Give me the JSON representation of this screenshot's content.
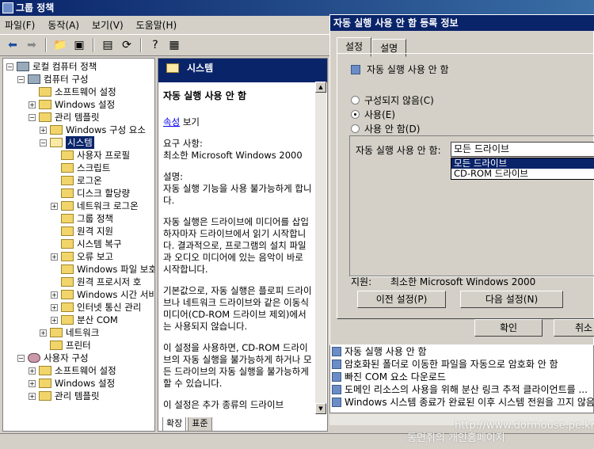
{
  "window": {
    "title": "그룹 정책"
  },
  "menu": [
    "파일(F)",
    "동작(A)",
    "보기(V)",
    "도움말(H)"
  ],
  "tree": [
    {
      "label": "로컬 컴퓨터 정책",
      "indent": 0,
      "pm": "−",
      "icon": "computer-policy-icon"
    },
    {
      "label": "컴퓨터 구성",
      "indent": 1,
      "pm": "−",
      "icon": "computer-icon"
    },
    {
      "label": "소프트웨어 설정",
      "indent": 2,
      "pm": "",
      "icon": "folder-icon"
    },
    {
      "label": "Windows 설정",
      "indent": 2,
      "pm": "+",
      "icon": "folder-icon"
    },
    {
      "label": "관리 템플릿",
      "indent": 2,
      "pm": "−",
      "icon": "folder-icon"
    },
    {
      "label": "Windows 구성 요소",
      "indent": 3,
      "pm": "+",
      "icon": "folder-icon"
    },
    {
      "label": "시스템",
      "indent": 3,
      "pm": "−",
      "icon": "open-folder-icon",
      "selected": true
    },
    {
      "label": "사용자 프로필",
      "indent": 4,
      "pm": "",
      "icon": "folder-icon"
    },
    {
      "label": "스크립트",
      "indent": 4,
      "pm": "",
      "icon": "folder-icon"
    },
    {
      "label": "로그온",
      "indent": 4,
      "pm": "",
      "icon": "folder-icon"
    },
    {
      "label": "디스크 할당량",
      "indent": 4,
      "pm": "",
      "icon": "folder-icon"
    },
    {
      "label": "네트워크 로그온",
      "indent": 4,
      "pm": "+",
      "icon": "folder-icon"
    },
    {
      "label": "그룹 정책",
      "indent": 4,
      "pm": "",
      "icon": "folder-icon"
    },
    {
      "label": "원격 지원",
      "indent": 4,
      "pm": "",
      "icon": "folder-icon"
    },
    {
      "label": "시스템 복구",
      "indent": 4,
      "pm": "",
      "icon": "folder-icon"
    },
    {
      "label": "오류 보고",
      "indent": 4,
      "pm": "+",
      "icon": "folder-icon"
    },
    {
      "label": "Windows 파일 보호",
      "indent": 4,
      "pm": "",
      "icon": "folder-icon"
    },
    {
      "label": "원격 프로시저 호",
      "indent": 4,
      "pm": "",
      "icon": "folder-icon"
    },
    {
      "label": "Windows 시간 서비",
      "indent": 4,
      "pm": "+",
      "icon": "folder-icon"
    },
    {
      "label": "인터넷 통신 관리",
      "indent": 4,
      "pm": "+",
      "icon": "folder-icon"
    },
    {
      "label": "분산 COM",
      "indent": 4,
      "pm": "+",
      "icon": "folder-icon"
    },
    {
      "label": "네트워크",
      "indent": 3,
      "pm": "+",
      "icon": "folder-icon"
    },
    {
      "label": "프린터",
      "indent": 3,
      "pm": "",
      "icon": "folder-icon"
    },
    {
      "label": "사용자 구성",
      "indent": 1,
      "pm": "−",
      "icon": "user-icon"
    },
    {
      "label": "소프트웨어 설정",
      "indent": 2,
      "pm": "+",
      "icon": "folder-icon"
    },
    {
      "label": "Windows 설정",
      "indent": 2,
      "pm": "+",
      "icon": "folder-icon"
    },
    {
      "label": "관리 템플릿",
      "indent": 2,
      "pm": "+",
      "icon": "folder-icon"
    }
  ],
  "pane": {
    "header": "시스템",
    "heading": "자동 실행 사용 안 함",
    "link": "속성",
    "link_suffix": " 보기",
    "req_label": "요구 사항:",
    "req_value": "최소한 Microsoft Windows 2000",
    "desc_label": "설명:",
    "desc1": "자동 실행 기능을 사용 불가능하게 합니다.",
    "desc2": "자동 실행은 드라이브에 미디어를 삽입하자마자 드라이브에서 읽기 시작합니다. 결과적으로, 프로그램의 설치 파일과 오디오 미디어에 있는 음악이 바로 시작합니다.",
    "desc3": "기본값으로, 자동 실행은 플로피 드라이브나 네트워크 드라이브와 같은 이동식 미디어(CD-ROM 드라이브 제외)에서는 사용되지 않습니다.",
    "desc4": "이 설정을 사용하면, CD-ROM 드라이브의 자동 실행을 불가능하게 하거나 모든 드라이브의 자동 실행을 불가능하게 할 수 있습니다.",
    "desc5": "이 설정은 추가 종류의 드라이브"
  },
  "bottom_tabs": [
    "확장",
    "표준"
  ],
  "dialog": {
    "title": "자동 실행 사용 안 함 등록 정보",
    "tabs": [
      "설정",
      "설명"
    ],
    "policy_name": "자동 실행 사용 안 함",
    "radios": [
      "구성되지 않음(C)",
      "사용(E)",
      "사용 안 함(D)"
    ],
    "selected_radio": 1,
    "option_label": "자동 실행 사용 안 함:",
    "combo_value": "모든 드라이브",
    "dropdown_options": [
      "모든 드라이브",
      "CD-ROM 드라이브"
    ],
    "support_label": "지원:",
    "support_value": "최소한 Microsoft Windows 2000",
    "prev_button": "이전 설정(P)",
    "next_button": "다음 설정(N)",
    "ok_button": "확인",
    "cancel_button": "취소"
  },
  "list": [
    "자동 실행 사용 안 함",
    "암호화된 폴더로 이동한 파일을 자동으로 암호화 안 함",
    "빠진 COM 요소 다운로드",
    "도메인 리소스의 사용을 위해 분산 링크 추적 클라이언트를 ...",
    "Windows 시스템 종료가 완료된 이후 시스템 전원을 끄지 않음"
  ],
  "watermark": [
    "http://www.dormouse.pe.kr/",
    "동면쥐의 개인홈페이지"
  ]
}
